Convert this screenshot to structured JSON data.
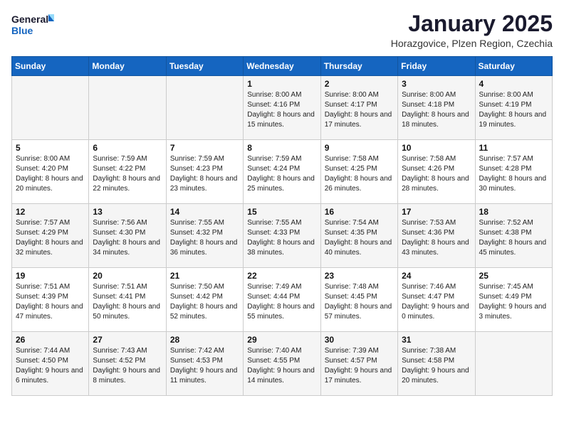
{
  "header": {
    "logo_general": "General",
    "logo_blue": "Blue",
    "month_title": "January 2025",
    "location": "Horazgovice, Plzen Region, Czechia"
  },
  "weekdays": [
    "Sunday",
    "Monday",
    "Tuesday",
    "Wednesday",
    "Thursday",
    "Friday",
    "Saturday"
  ],
  "weeks": [
    [
      {
        "day": "",
        "sunrise": "",
        "sunset": "",
        "daylight": ""
      },
      {
        "day": "",
        "sunrise": "",
        "sunset": "",
        "daylight": ""
      },
      {
        "day": "",
        "sunrise": "",
        "sunset": "",
        "daylight": ""
      },
      {
        "day": "1",
        "sunrise": "Sunrise: 8:00 AM",
        "sunset": "Sunset: 4:16 PM",
        "daylight": "Daylight: 8 hours and 15 minutes."
      },
      {
        "day": "2",
        "sunrise": "Sunrise: 8:00 AM",
        "sunset": "Sunset: 4:17 PM",
        "daylight": "Daylight: 8 hours and 17 minutes."
      },
      {
        "day": "3",
        "sunrise": "Sunrise: 8:00 AM",
        "sunset": "Sunset: 4:18 PM",
        "daylight": "Daylight: 8 hours and 18 minutes."
      },
      {
        "day": "4",
        "sunrise": "Sunrise: 8:00 AM",
        "sunset": "Sunset: 4:19 PM",
        "daylight": "Daylight: 8 hours and 19 minutes."
      }
    ],
    [
      {
        "day": "5",
        "sunrise": "Sunrise: 8:00 AM",
        "sunset": "Sunset: 4:20 PM",
        "daylight": "Daylight: 8 hours and 20 minutes."
      },
      {
        "day": "6",
        "sunrise": "Sunrise: 7:59 AM",
        "sunset": "Sunset: 4:22 PM",
        "daylight": "Daylight: 8 hours and 22 minutes."
      },
      {
        "day": "7",
        "sunrise": "Sunrise: 7:59 AM",
        "sunset": "Sunset: 4:23 PM",
        "daylight": "Daylight: 8 hours and 23 minutes."
      },
      {
        "day": "8",
        "sunrise": "Sunrise: 7:59 AM",
        "sunset": "Sunset: 4:24 PM",
        "daylight": "Daylight: 8 hours and 25 minutes."
      },
      {
        "day": "9",
        "sunrise": "Sunrise: 7:58 AM",
        "sunset": "Sunset: 4:25 PM",
        "daylight": "Daylight: 8 hours and 26 minutes."
      },
      {
        "day": "10",
        "sunrise": "Sunrise: 7:58 AM",
        "sunset": "Sunset: 4:26 PM",
        "daylight": "Daylight: 8 hours and 28 minutes."
      },
      {
        "day": "11",
        "sunrise": "Sunrise: 7:57 AM",
        "sunset": "Sunset: 4:28 PM",
        "daylight": "Daylight: 8 hours and 30 minutes."
      }
    ],
    [
      {
        "day": "12",
        "sunrise": "Sunrise: 7:57 AM",
        "sunset": "Sunset: 4:29 PM",
        "daylight": "Daylight: 8 hours and 32 minutes."
      },
      {
        "day": "13",
        "sunrise": "Sunrise: 7:56 AM",
        "sunset": "Sunset: 4:30 PM",
        "daylight": "Daylight: 8 hours and 34 minutes."
      },
      {
        "day": "14",
        "sunrise": "Sunrise: 7:55 AM",
        "sunset": "Sunset: 4:32 PM",
        "daylight": "Daylight: 8 hours and 36 minutes."
      },
      {
        "day": "15",
        "sunrise": "Sunrise: 7:55 AM",
        "sunset": "Sunset: 4:33 PM",
        "daylight": "Daylight: 8 hours and 38 minutes."
      },
      {
        "day": "16",
        "sunrise": "Sunrise: 7:54 AM",
        "sunset": "Sunset: 4:35 PM",
        "daylight": "Daylight: 8 hours and 40 minutes."
      },
      {
        "day": "17",
        "sunrise": "Sunrise: 7:53 AM",
        "sunset": "Sunset: 4:36 PM",
        "daylight": "Daylight: 8 hours and 43 minutes."
      },
      {
        "day": "18",
        "sunrise": "Sunrise: 7:52 AM",
        "sunset": "Sunset: 4:38 PM",
        "daylight": "Daylight: 8 hours and 45 minutes."
      }
    ],
    [
      {
        "day": "19",
        "sunrise": "Sunrise: 7:51 AM",
        "sunset": "Sunset: 4:39 PM",
        "daylight": "Daylight: 8 hours and 47 minutes."
      },
      {
        "day": "20",
        "sunrise": "Sunrise: 7:51 AM",
        "sunset": "Sunset: 4:41 PM",
        "daylight": "Daylight: 8 hours and 50 minutes."
      },
      {
        "day": "21",
        "sunrise": "Sunrise: 7:50 AM",
        "sunset": "Sunset: 4:42 PM",
        "daylight": "Daylight: 8 hours and 52 minutes."
      },
      {
        "day": "22",
        "sunrise": "Sunrise: 7:49 AM",
        "sunset": "Sunset: 4:44 PM",
        "daylight": "Daylight: 8 hours and 55 minutes."
      },
      {
        "day": "23",
        "sunrise": "Sunrise: 7:48 AM",
        "sunset": "Sunset: 4:45 PM",
        "daylight": "Daylight: 8 hours and 57 minutes."
      },
      {
        "day": "24",
        "sunrise": "Sunrise: 7:46 AM",
        "sunset": "Sunset: 4:47 PM",
        "daylight": "Daylight: 9 hours and 0 minutes."
      },
      {
        "day": "25",
        "sunrise": "Sunrise: 7:45 AM",
        "sunset": "Sunset: 4:49 PM",
        "daylight": "Daylight: 9 hours and 3 minutes."
      }
    ],
    [
      {
        "day": "26",
        "sunrise": "Sunrise: 7:44 AM",
        "sunset": "Sunset: 4:50 PM",
        "daylight": "Daylight: 9 hours and 6 minutes."
      },
      {
        "day": "27",
        "sunrise": "Sunrise: 7:43 AM",
        "sunset": "Sunset: 4:52 PM",
        "daylight": "Daylight: 9 hours and 8 minutes."
      },
      {
        "day": "28",
        "sunrise": "Sunrise: 7:42 AM",
        "sunset": "Sunset: 4:53 PM",
        "daylight": "Daylight: 9 hours and 11 minutes."
      },
      {
        "day": "29",
        "sunrise": "Sunrise: 7:40 AM",
        "sunset": "Sunset: 4:55 PM",
        "daylight": "Daylight: 9 hours and 14 minutes."
      },
      {
        "day": "30",
        "sunrise": "Sunrise: 7:39 AM",
        "sunset": "Sunset: 4:57 PM",
        "daylight": "Daylight: 9 hours and 17 minutes."
      },
      {
        "day": "31",
        "sunrise": "Sunrise: 7:38 AM",
        "sunset": "Sunset: 4:58 PM",
        "daylight": "Daylight: 9 hours and 20 minutes."
      },
      {
        "day": "",
        "sunrise": "",
        "sunset": "",
        "daylight": ""
      }
    ]
  ]
}
